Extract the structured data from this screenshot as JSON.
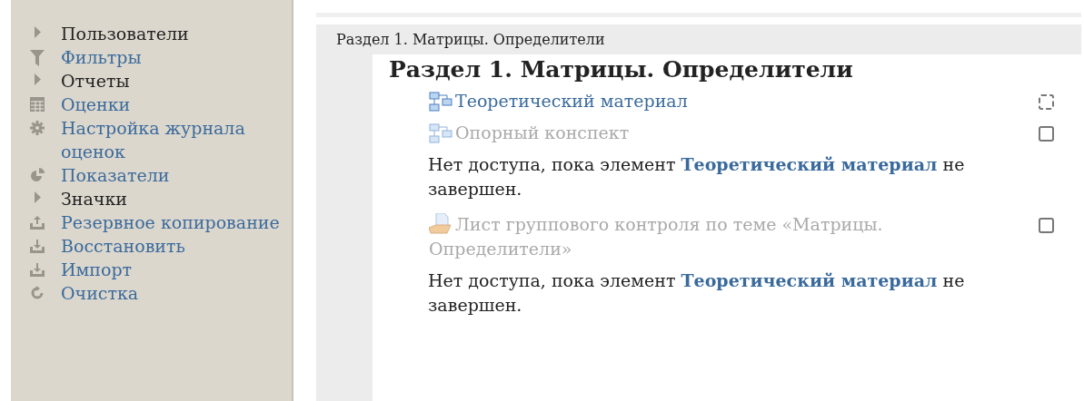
{
  "sidebar": {
    "items": [
      {
        "label": "Пользователи",
        "kind": "folder"
      },
      {
        "label": "Фильтры",
        "kind": "filter"
      },
      {
        "label": "Отчеты",
        "kind": "folder"
      },
      {
        "label": "Оценки",
        "kind": "grades"
      },
      {
        "label": "Настройка журнала оценок",
        "kind": "settings"
      },
      {
        "label": "Показатели",
        "kind": "outcomes"
      },
      {
        "label": "Значки",
        "kind": "folder"
      },
      {
        "label": "Резервное копирование",
        "kind": "backup"
      },
      {
        "label": "Восстановить",
        "kind": "restore"
      },
      {
        "label": "Импорт",
        "kind": "restore"
      },
      {
        "label": "Очистка",
        "kind": "reset"
      }
    ]
  },
  "section": {
    "breadcrumb": "Раздел 1. Матрицы. Определители",
    "title": "Раздел 1. Матрицы. Определители",
    "items": [
      {
        "kind": "page",
        "label": "Теоретический материал",
        "dimmed": false,
        "checkbox": {
          "kind": "automatic",
          "checked": false
        }
      },
      {
        "kind": "page",
        "label": "Опорный конспект",
        "dimmed": true,
        "checkbox": {
          "kind": "manual",
          "checked": false
        }
      },
      {
        "kind": "restriction",
        "text": "Нет доступа, пока элемент **Теоретический материал** не завершен."
      },
      {
        "kind": "assignment",
        "label": "Лист группового контроля по теме «Матрицы. Определители»",
        "dimmed": true,
        "checkbox": {
          "kind": "manual",
          "checked": false
        }
      },
      {
        "kind": "restriction",
        "text": "Нет доступа, пока элемент **Теоретический материал** не завершен."
      }
    ]
  }
}
